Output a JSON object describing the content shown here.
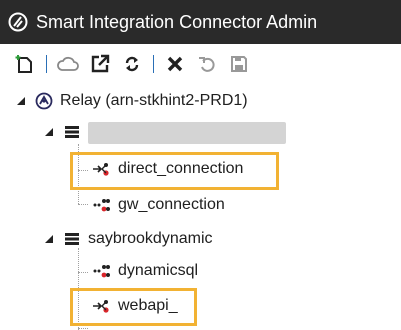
{
  "window": {
    "title": "Smart Integration Connector Admin"
  },
  "toolbar": {
    "buttons": [
      {
        "icon": "new-document-icon"
      },
      {
        "icon": "cloud-icon"
      },
      {
        "icon": "open-external-icon"
      },
      {
        "icon": "refresh-icon"
      },
      {
        "icon": "delete-icon"
      },
      {
        "icon": "undo-icon"
      },
      {
        "icon": "save-icon"
      }
    ]
  },
  "tree": {
    "relay": {
      "label": "Relay (arn-stkhint2-PRD1)",
      "expanded": true
    },
    "group1": {
      "label": "",
      "expanded": true,
      "redacted": true
    },
    "direct_connection": {
      "label": "direct_connection",
      "highlighted": true
    },
    "gw_connection": {
      "label": "gw_connection",
      "highlighted": false
    },
    "group2": {
      "label": "saybrookdynamic",
      "expanded": true
    },
    "dynamicsql": {
      "label": "dynamicsql",
      "highlighted": false
    },
    "webapi": {
      "label": "webapi_",
      "highlighted": true
    }
  },
  "colors": {
    "titlebar": "#2a2a2a",
    "highlight": "#f2b233",
    "accent": "#2a6fb6",
    "delete": "#d9252a"
  }
}
